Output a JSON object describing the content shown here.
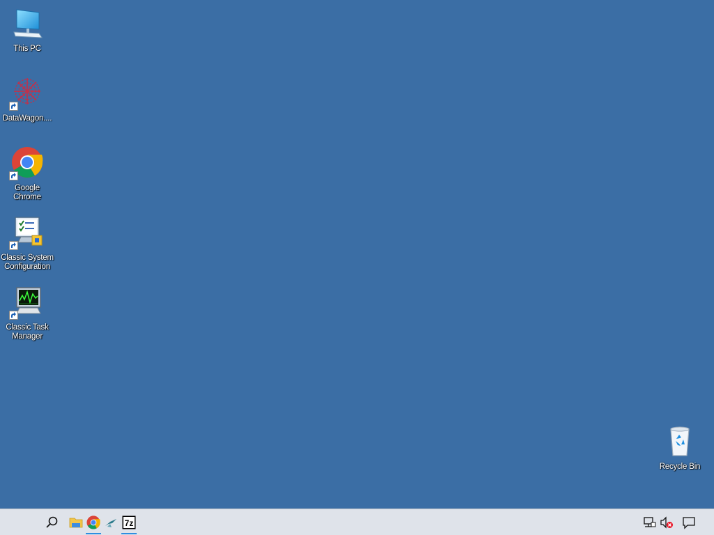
{
  "desktop": {
    "background_color": "#3b6ea5",
    "icons": [
      {
        "label": "This PC",
        "icon": "computer-icon",
        "shortcut": false
      },
      {
        "label": "DataWagon....",
        "icon": "datawagon-icon",
        "shortcut": true
      },
      {
        "label": "Google Chrome",
        "icon": "chrome-icon",
        "shortcut": true
      },
      {
        "label": "Classic System Configuration",
        "icon": "system-configuration-icon",
        "shortcut": true
      },
      {
        "label": "Classic Task Manager",
        "icon": "task-manager-icon",
        "shortcut": true
      },
      {
        "label": "Recycle Bin",
        "icon": "recycle-bin-icon",
        "shortcut": false
      }
    ]
  },
  "taskbar": {
    "background_color": "#dfe3ea",
    "search": {
      "icon": "search-icon"
    },
    "pinned": [
      {
        "name": "File Explorer",
        "icon": "folder-icon",
        "active": false
      },
      {
        "name": "Google Chrome",
        "icon": "chrome-icon",
        "active": true
      },
      {
        "name": "App",
        "icon": "bird-icon",
        "active": false
      },
      {
        "name": "7-Zip",
        "icon": "7zip-icon",
        "text": "7z",
        "active": true
      }
    ],
    "tray": [
      {
        "icon": "network-icon"
      },
      {
        "icon": "speaker-muted-icon"
      },
      {
        "icon": "action-center-icon"
      }
    ]
  }
}
